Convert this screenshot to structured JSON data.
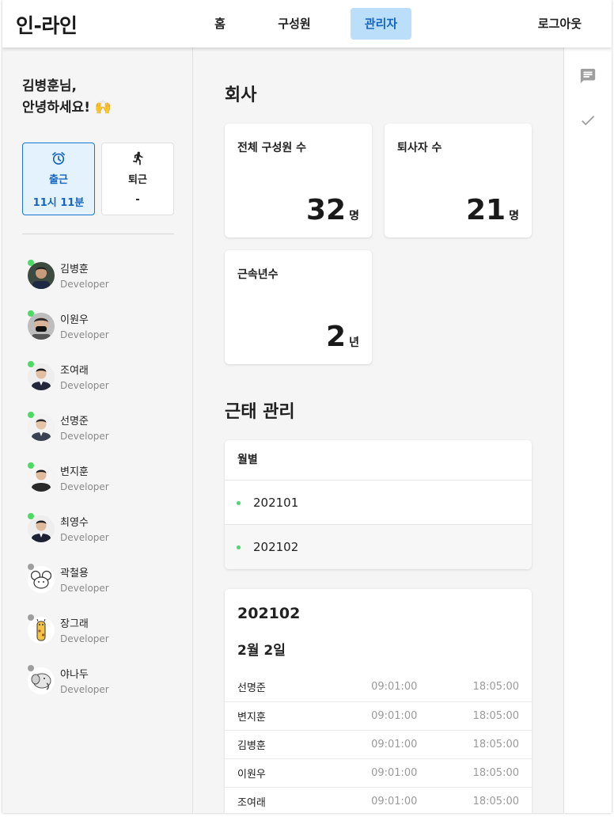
{
  "header": {
    "logo": "인-라인",
    "nav": [
      {
        "label": "홈",
        "active": false
      },
      {
        "label": "구성원",
        "active": false
      },
      {
        "label": "관리자",
        "active": true
      }
    ],
    "logout": "로그아웃"
  },
  "sidebar": {
    "greeting_line1": "김병훈님,",
    "greeting_line2": "안녕하세요! 🙌",
    "clock_in": {
      "label": "출근",
      "time": "11시 11분",
      "icon": "alarm-clock-icon"
    },
    "clock_out": {
      "label": "퇴근",
      "time": "-",
      "icon": "walking-person-icon"
    },
    "members": [
      {
        "name": "김병훈",
        "role": "Developer",
        "online": true,
        "avatar": "photo"
      },
      {
        "name": "이원우",
        "role": "Developer",
        "online": true,
        "avatar": "photo"
      },
      {
        "name": "조여래",
        "role": "Developer",
        "online": true,
        "avatar": "photo"
      },
      {
        "name": "선명준",
        "role": "Developer",
        "online": true,
        "avatar": "photo"
      },
      {
        "name": "변지훈",
        "role": "Developer",
        "online": true,
        "avatar": "photo"
      },
      {
        "name": "최영수",
        "role": "Developer",
        "online": true,
        "avatar": "photo"
      },
      {
        "name": "곽철용",
        "role": "Developer",
        "online": false,
        "avatar": "mouse-illustration"
      },
      {
        "name": "장그래",
        "role": "Developer",
        "online": false,
        "avatar": "giraffe-illustration"
      },
      {
        "name": "야나두",
        "role": "Developer",
        "online": false,
        "avatar": "elephant-illustration"
      }
    ]
  },
  "company": {
    "title": "회사",
    "stats": [
      {
        "label": "전체 구성원 수",
        "value": "32",
        "unit": "명"
      },
      {
        "label": "퇴사자 수",
        "value": "21",
        "unit": "명"
      },
      {
        "label": "근속년수",
        "value": "2",
        "unit": "년"
      }
    ]
  },
  "attendance": {
    "title": "근태 관리",
    "monthly_header": "월별",
    "months": [
      "202101",
      "202102"
    ],
    "selected_month": "202102",
    "detail_month": "202102",
    "detail_date": "2월 2일",
    "records": [
      {
        "name": "선명준",
        "in": "09:01:00",
        "out": "18:05:00"
      },
      {
        "name": "변지훈",
        "in": "09:01:00",
        "out": "18:05:00"
      },
      {
        "name": "김병훈",
        "in": "09:01:00",
        "out": "18:05:00"
      },
      {
        "name": "이원우",
        "in": "09:01:00",
        "out": "18:05:00"
      },
      {
        "name": "조여래",
        "in": "09:01:00",
        "out": "18:05:00"
      }
    ]
  },
  "right_rail": {
    "icons": [
      "message-icon",
      "check-icon"
    ]
  },
  "colors": {
    "accent": "#1565c0",
    "accent_bg": "#bbdefb",
    "online": "#4cd964",
    "offline": "#9e9e9e",
    "bullet": "#4cd964"
  }
}
